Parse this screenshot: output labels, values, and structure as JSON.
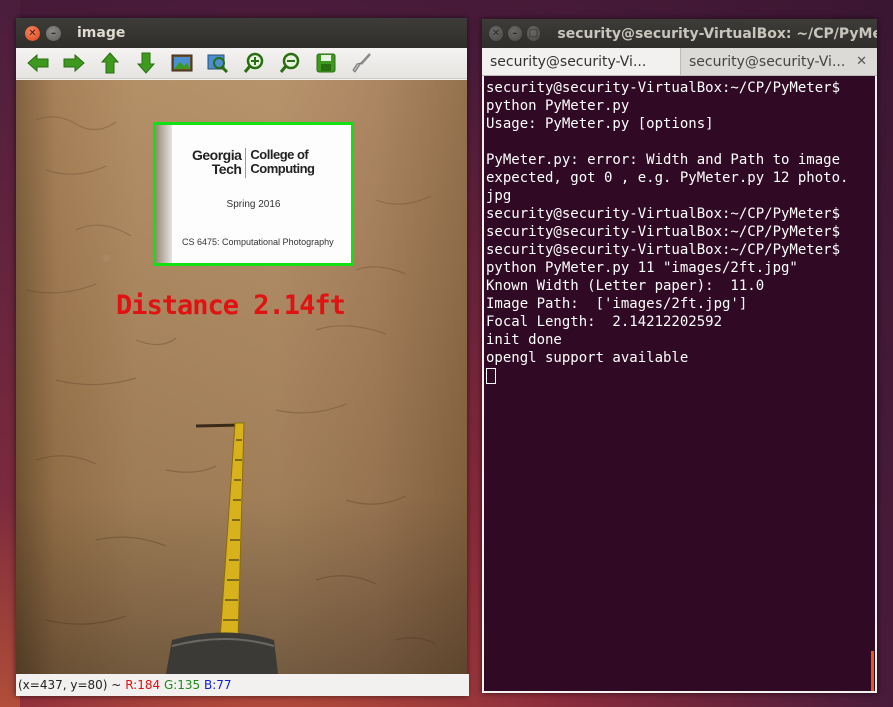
{
  "image_window": {
    "title": "image",
    "toolbar": [
      {
        "name": "pan-left-icon"
      },
      {
        "name": "pan-right-icon"
      },
      {
        "name": "pan-up-icon"
      },
      {
        "name": "pan-down-icon"
      },
      {
        "name": "zoom-fit-icon"
      },
      {
        "name": "zoom-in-region-icon"
      },
      {
        "name": "zoom-in-icon"
      },
      {
        "name": "zoom-out-icon"
      },
      {
        "name": "save-icon"
      },
      {
        "name": "properties-brush-icon"
      }
    ],
    "photo": {
      "paper_logo_left": [
        "Georgia",
        "Tech"
      ],
      "paper_logo_right": [
        "College of",
        "Computing"
      ],
      "paper_semester": "Spring 2016",
      "paper_course": "CS 6475: Computational Photography",
      "overlay_text": "Distance 2.14ft",
      "overlay_color": "#e01212",
      "box_color": "#12e012"
    },
    "status": {
      "coords": "(x=437, y=80) ~",
      "r": "R:184",
      "g": "G:135",
      "b": "B:77"
    }
  },
  "terminal_window": {
    "title": "security@security-VirtualBox: ~/CP/PyMeter",
    "tabs": [
      {
        "label": "security@security-Vi...",
        "active": true
      },
      {
        "label": "security@security-Vi...",
        "active": false
      }
    ],
    "lines": [
      "security@security-VirtualBox:~/CP/PyMeter$",
      "python PyMeter.py",
      "Usage: PyMeter.py [options]",
      "",
      "PyMeter.py: error: Width and Path to image",
      "expected, got 0 , e.g. PyMeter.py 12 photo.",
      "jpg",
      "security@security-VirtualBox:~/CP/PyMeter$",
      "security@security-VirtualBox:~/CP/PyMeter$",
      "security@security-VirtualBox:~/CP/PyMeter$",
      "python PyMeter.py 11 \"images/2ft.jpg\"",
      "Known Width (Letter paper):  11.0",
      "Image Path:  ['images/2ft.jpg']",
      "Focal Length:  2.14212202592",
      "init done",
      "opengl support available"
    ],
    "background": "#300a24",
    "accent": "#e95420"
  }
}
